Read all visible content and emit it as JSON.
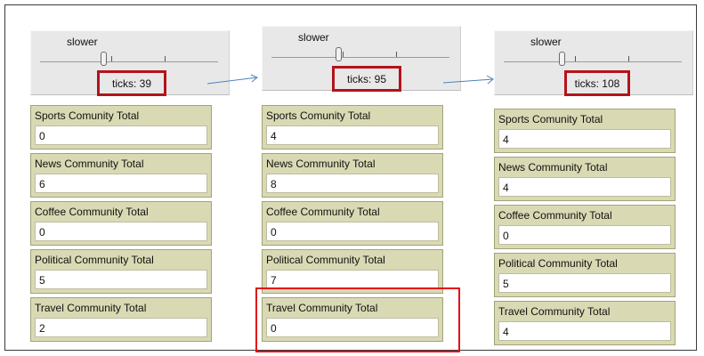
{
  "panels": [
    {
      "speed_label": "slower",
      "ticks_label": "ticks: 39",
      "monitors": [
        {
          "label": "Sports Comunity Total",
          "value": "0"
        },
        {
          "label": "News Community Total",
          "value": "6"
        },
        {
          "label": "Coffee Community Total",
          "value": "0"
        },
        {
          "label": "Political Community Total",
          "value": "5"
        },
        {
          "label": "Travel Community Total",
          "value": "2"
        }
      ]
    },
    {
      "speed_label": "slower",
      "ticks_label": "ticks: 95",
      "monitors": [
        {
          "label": "Sports Comunity Total",
          "value": "4"
        },
        {
          "label": "News Community Total",
          "value": "8"
        },
        {
          "label": "Coffee Community Total",
          "value": "0"
        },
        {
          "label": "Political Community Total",
          "value": "7"
        },
        {
          "label": "Travel Community Total",
          "value": "0"
        }
      ]
    },
    {
      "speed_label": "slower",
      "ticks_label": "ticks: 108",
      "monitors": [
        {
          "label": "Sports Comunity Total",
          "value": "4"
        },
        {
          "label": "News Community Total",
          "value": "4"
        },
        {
          "label": "Coffee Community Total",
          "value": "0"
        },
        {
          "label": "Political Community Total",
          "value": "5"
        },
        {
          "label": "Travel Community Total",
          "value": "4"
        }
      ]
    }
  ],
  "colors": {
    "highlight": "#b3131b",
    "arrow": "#4f81bd",
    "monitor_bg": "#d9d9b4"
  }
}
